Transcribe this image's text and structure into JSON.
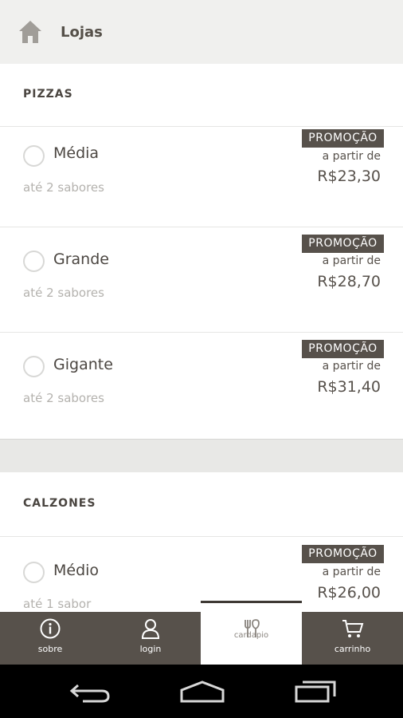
{
  "topbar": {
    "title": "Lojas"
  },
  "sections": [
    {
      "title": "PIZZAS",
      "items": [
        {
          "name": "Média",
          "subtitle": "até 2 sabores",
          "badge": "PROMOÇÃO",
          "from_label": "a partir de",
          "price": "R$23,30"
        },
        {
          "name": "Grande",
          "subtitle": "até 2 sabores",
          "badge": "PROMOÇÃO",
          "from_label": "a partir de",
          "price": "R$28,70"
        },
        {
          "name": "Gigante",
          "subtitle": "até 2 sabores",
          "badge": "PROMOÇÃO",
          "from_label": "a partir de",
          "price": "R$31,40"
        }
      ]
    },
    {
      "title": "CALZONES",
      "items": [
        {
          "name": "Médio",
          "subtitle": "até 1 sabor",
          "badge": "PROMOÇÃO",
          "from_label": "a partir de",
          "price": "R$26,00"
        }
      ]
    }
  ],
  "tabbar": {
    "tabs": [
      {
        "label": "sobre",
        "icon": "info-icon",
        "active": false
      },
      {
        "label": "login",
        "icon": "user-icon",
        "active": false
      },
      {
        "label": "cardapio",
        "icon": "cutlery-icon",
        "active": true
      },
      {
        "label": "carrinho",
        "icon": "cart-icon",
        "active": false
      }
    ]
  },
  "colors": {
    "accent": "#57514b",
    "topbar_bg": "#f0f0ee",
    "nav_bg": "#000000"
  }
}
